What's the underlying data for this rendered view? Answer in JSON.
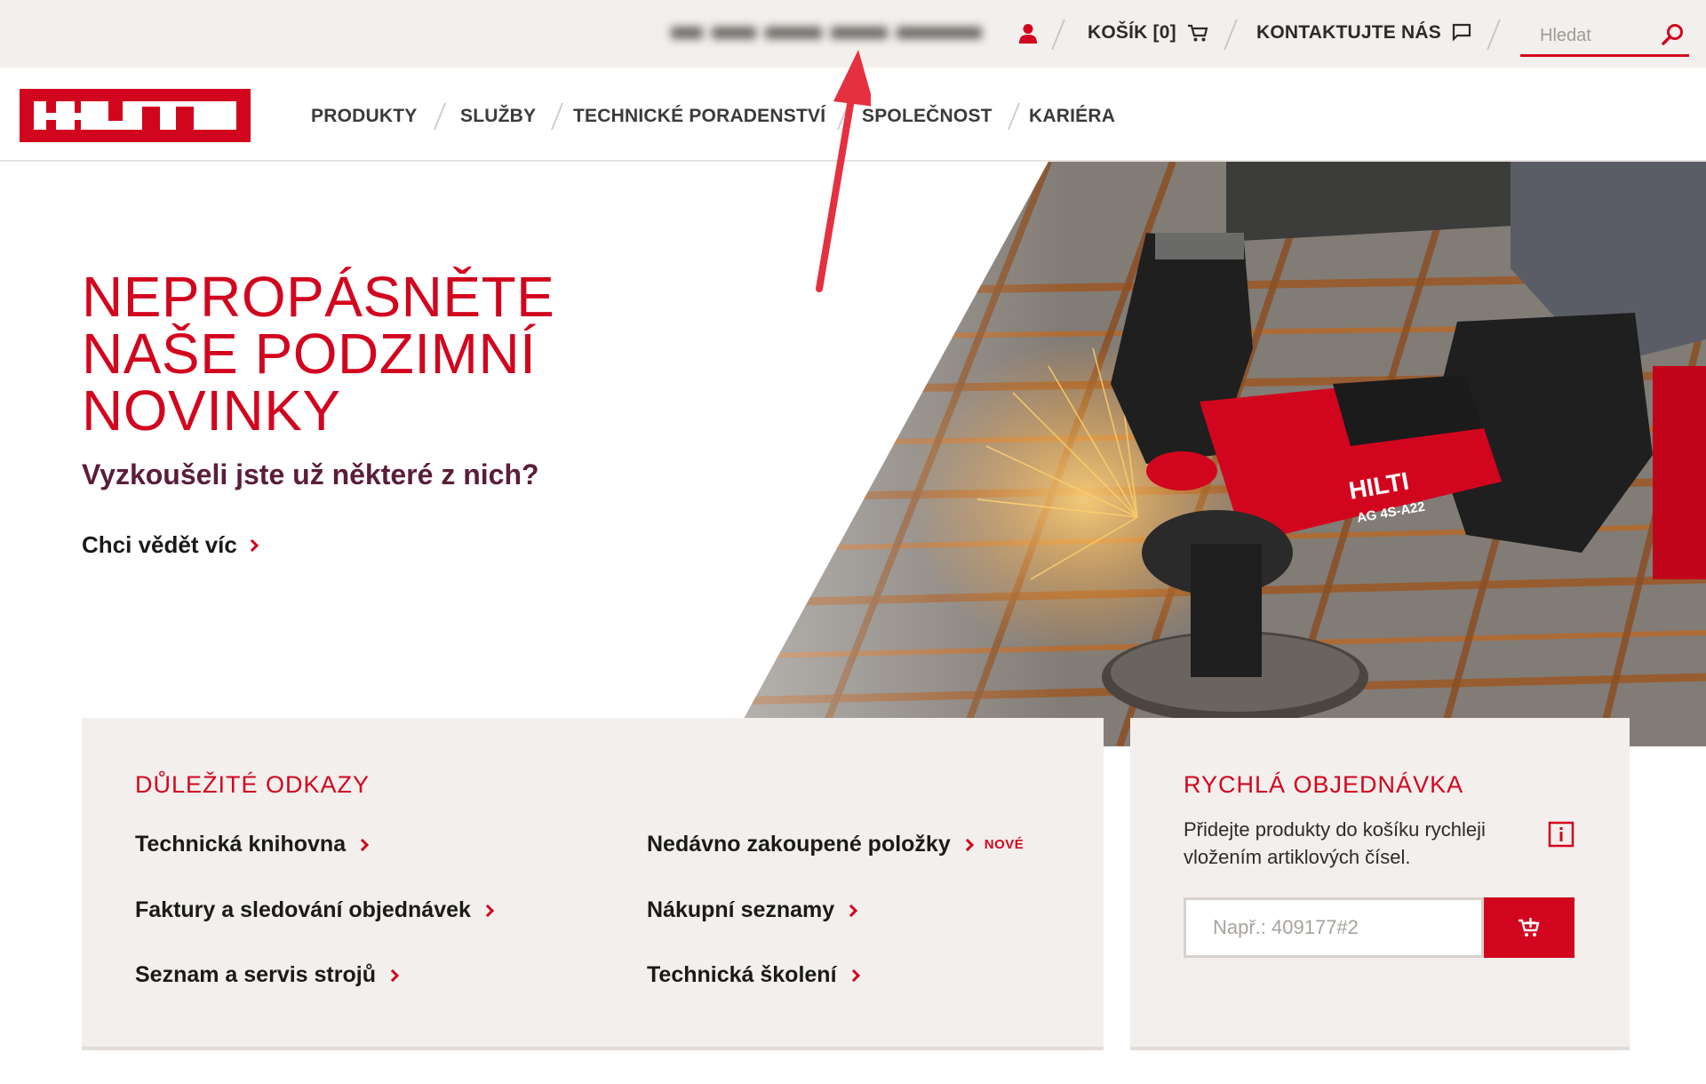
{
  "topbar": {
    "cart_label": "KOŠÍK [0]",
    "contact_label": "KONTAKTUJTE NÁS",
    "search_placeholder": "Hledat"
  },
  "header": {
    "logo_text": "HILTI",
    "nav": [
      {
        "label": "PRODUKTY"
      },
      {
        "label": "SLUŽBY"
      },
      {
        "label": "TECHNICKÉ PORADENSTVÍ"
      },
      {
        "label": "SPOLEČNOST"
      },
      {
        "label": "KARIÉRA"
      }
    ]
  },
  "hero": {
    "title_line1": "NEPROPÁSNĚTE",
    "title_line2": "NAŠE PODZIMNÍ",
    "title_line3": "NOVINKY",
    "subtitle": "Vyzkoušeli jste už některé z nich?",
    "cta": "Chci vědět víc",
    "tool_brand": "HILTI",
    "tool_model": "AG 4S-A22"
  },
  "links_panel": {
    "title": "DŮLEŽITÉ ODKAZY",
    "items": [
      {
        "label": "Technická knihovna"
      },
      {
        "label": "Faktury a sledování objednávek"
      },
      {
        "label": "Seznam a servis strojů"
      },
      {
        "label": "Nedávno zakoupené položky",
        "badge": "NOVÉ"
      },
      {
        "label": "Nákupní seznamy"
      },
      {
        "label": "Technická školení"
      }
    ]
  },
  "order_panel": {
    "title": "RYCHLÁ OBJEDNÁVKA",
    "description": "Přidejte produkty do košíku rychleji vložením artiklových čísel.",
    "input_placeholder": "Např.: 409177#2"
  },
  "colors": {
    "brand_red": "#d2051e",
    "topbar_bg": "#f2efec",
    "subtitle_color": "#5a1d3a"
  },
  "icons": [
    "person-icon",
    "cart-icon",
    "chat-icon",
    "search-icon",
    "chevron-right-icon",
    "info-icon",
    "add-to-cart-icon"
  ]
}
